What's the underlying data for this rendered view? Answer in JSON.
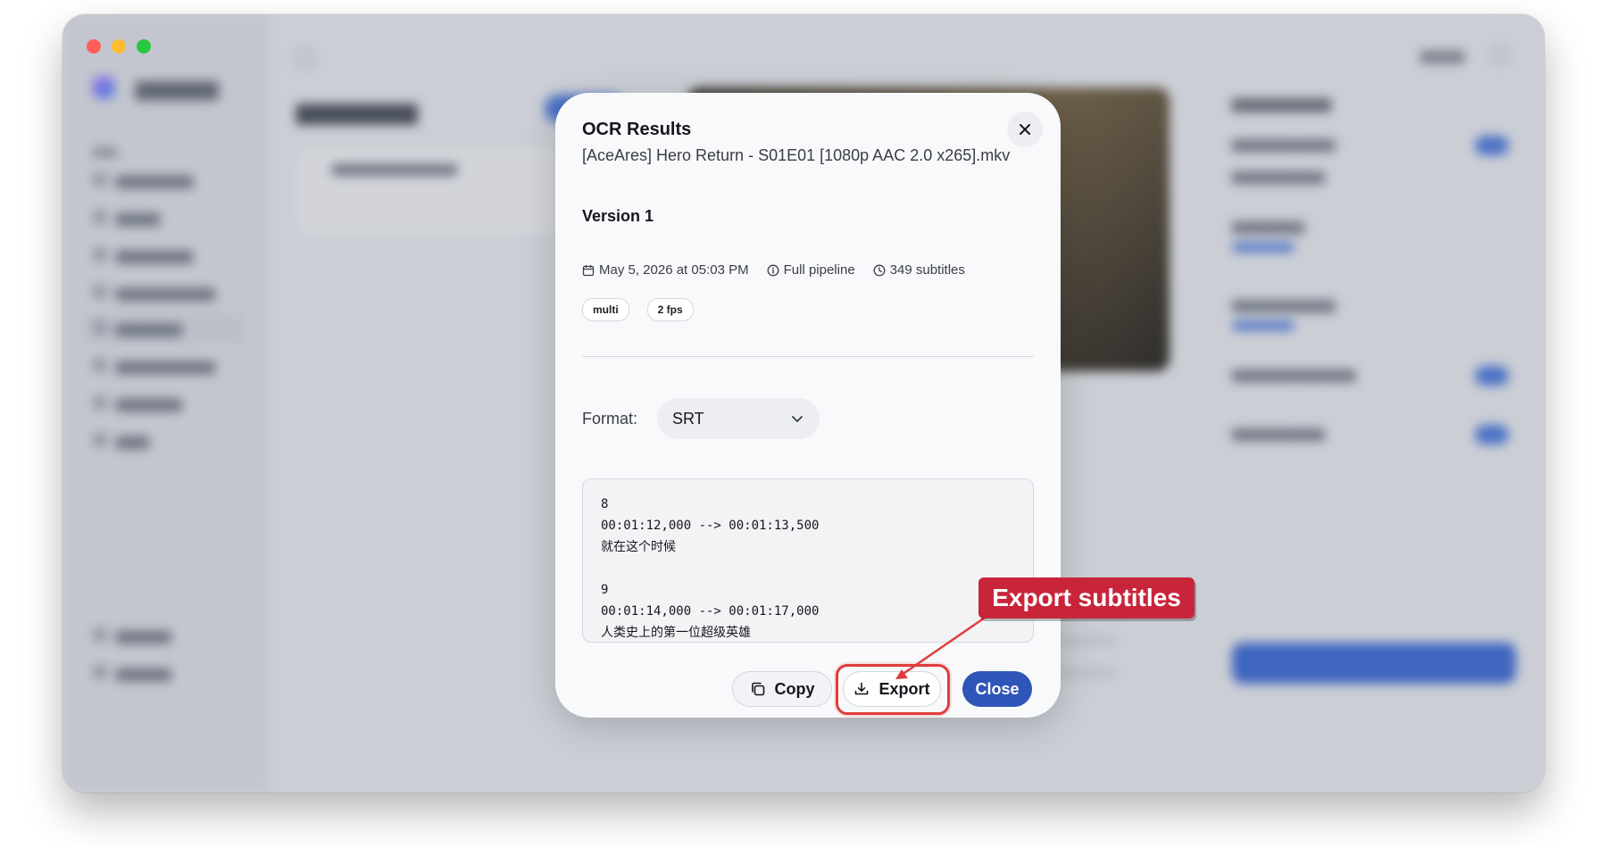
{
  "modal": {
    "title": "OCR Results",
    "filename": "[AceAres] Hero Return - S01E01 [1080p AAC 2.0 x265].mkv",
    "version_label": "Version 1",
    "meta": {
      "date": "May 5, 2026 at 05:03 PM",
      "pipeline": "Full pipeline",
      "subtitle_count": "349 subtitles"
    },
    "tags": [
      "multi",
      "2 fps"
    ],
    "format_label": "Format:",
    "format_value": "SRT",
    "preview_lines": [
      "8",
      "00:01:12,000 --> 00:01:13,500",
      "就在这个时候",
      "",
      "9",
      "00:01:14,000 --> 00:01:17,000",
      "人类史上的第一位超级英雄"
    ],
    "buttons": {
      "copy": "Copy",
      "export": "Export",
      "close": "Close"
    }
  },
  "annotation": {
    "callout_text": "Export subtitles",
    "callout_color": "#c8253b",
    "highlight_color": "#e03c3c"
  },
  "colors": {
    "primary": "#2e55b8",
    "modal_bg": "#f8f9fb"
  },
  "icons": {
    "close": "close-icon",
    "calendar": "calendar-icon",
    "info": "info-icon",
    "clock": "clock-icon",
    "chevron": "chevron-down-icon",
    "copy": "copy-icon",
    "export": "download-icon"
  }
}
